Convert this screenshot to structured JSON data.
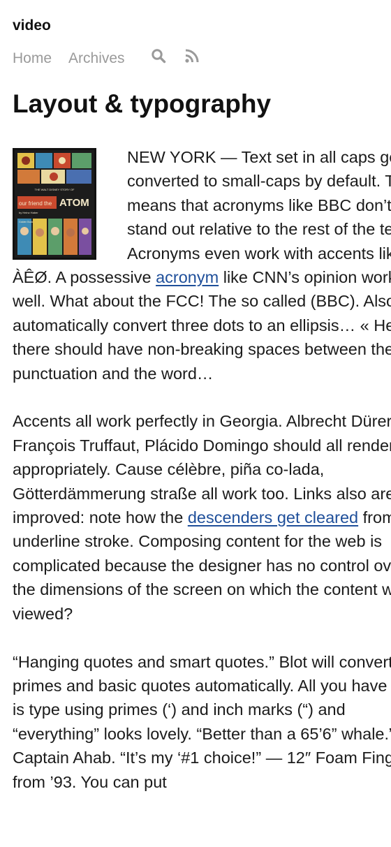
{
  "site": {
    "title": "video"
  },
  "nav": {
    "home": "Home",
    "archives": "Archives",
    "search_icon": "search-icon",
    "rss_icon": "rss-icon",
    "icon_color": "#9a9a9a"
  },
  "post": {
    "title": "Layout & typography",
    "cover": {
      "line1": "THE WALT DISNEY STORY OF",
      "line2_a": "our friend the",
      "line2_b": "ATOM",
      "line3": "by Heinz Haber",
      "line4": "Golden Book"
    },
    "p1": {
      "text_a": "NEW YORK — Text set in all caps gets converted to small-caps by default. This means that acronyms like BBC don’t stand out relative to the rest of the text. Acronyms even work with accents like ÀÊØ. A possessive ",
      "link": "acronym",
      "text_b": " like CNN’s opinion works as well. What about the FCC! The so called (BBC). Also I automatically convert three dots to an ellipsis… « Hello » there should have non-breaking spaces between the punctuation and the word…"
    },
    "p2": {
      "text_a": "Accents all work perfectly in Georgia. Albrecht Dürer, François Truffaut, Plácido Domingo should all render appropriately. Cause célèbre, piña co-lada, Götterdämmerung straße all work too. Links also are improved: note how the ",
      "link": "descenders get cleared",
      "text_b": " from the underline stroke. Composing content for the web is complicated because the designer has no control over the dimensions of the screen on which the content will be viewed?"
    },
    "p3": {
      "text": "“Hanging quotes and smart quotes.” Blot will convert primes and basic quotes automatically. All you have to do is type using primes (‘) and inch marks (“) and “everything” looks lovely. “Better than a 65’6” whale.” — Captain Ahab. “It’s my ‘#1 choice!” — 12″ Foam Finger from ’93. You can put"
    }
  },
  "colors": {
    "link": "#1f4f9a",
    "nav": "#9a9a9a",
    "text": "#1b1b1b"
  }
}
